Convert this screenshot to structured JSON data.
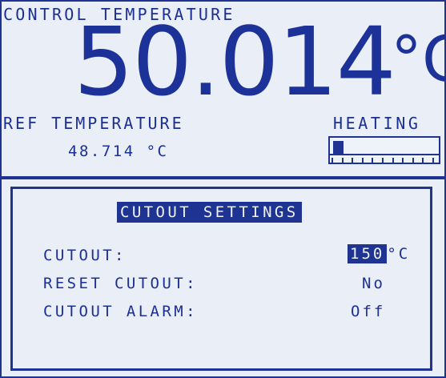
{
  "control": {
    "label": "CONTROL TEMPERATURE",
    "value": "50.014",
    "unit": "°C"
  },
  "reference": {
    "label": "REF TEMPERATURE",
    "value": "48.714 °C"
  },
  "heating": {
    "label": "HEATING",
    "level_fraction": 0.1
  },
  "cutout_settings": {
    "title": "CUTOUT SETTINGS",
    "cutout": {
      "label": "CUTOUT:",
      "value": "150",
      "unit": "°C"
    },
    "reset_cutout": {
      "label": "RESET CUTOUT:",
      "value": "No"
    },
    "cutout_alarm": {
      "label": "CUTOUT ALARM:",
      "value": "Off"
    }
  },
  "colors": {
    "lcd_blue": "#1e3392",
    "lcd_background": "#e9eef7"
  }
}
